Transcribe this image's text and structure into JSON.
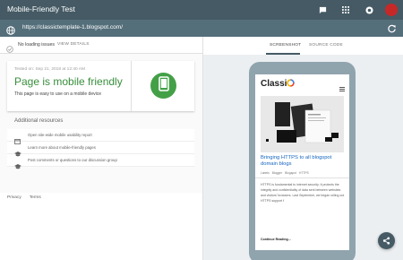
{
  "app": {
    "title": "Mobile-Friendly Test"
  },
  "urlbar": {
    "url": "https://classictemplate-1.blogspot.com/"
  },
  "status": {
    "issues": "No loading issues",
    "view_details": "VIEW DETAILS"
  },
  "result": {
    "tested_on": "Tested on: Sep 21, 2018 at 12:40 AM",
    "title": "Page is mobile friendly",
    "subtitle": "This page is easy to use on a mobile device"
  },
  "resources": {
    "title": "Additional resources",
    "items": [
      {
        "label": "Open site-wide mobile usability report",
        "icon": "report-icon"
      },
      {
        "label": "Learn more about mobile-friendly pages",
        "icon": "school-icon"
      },
      {
        "label": "Post comments or questions to our discussion group",
        "icon": "school-icon"
      }
    ]
  },
  "footer": {
    "privacy": "Privacy",
    "terms": "Terms"
  },
  "tabs": {
    "screenshot": "SCREENSHOT",
    "source": "SOURCE CODE",
    "active": "screenshot"
  },
  "preview": {
    "logo": "Classi",
    "post_title": "Bringing HTTPS to all blogspot domain blogs",
    "labels": [
      "Labels",
      "Blogger",
      "Blogspot",
      "HTTPS"
    ],
    "body": "HTTPS is fundamental to internet security; it protects the integrity and confidentiality of data sent between websites and visitors' browsers. Last September, we began rolling out HTTPS support f",
    "continue": "Continue Reading..."
  },
  "colors": {
    "appbar": "#455a64",
    "urlbar": "#546e7a",
    "success": "#388e3c",
    "badge": "#43a047",
    "phone_frame": "#90a4ae",
    "link": "#1565c0"
  }
}
